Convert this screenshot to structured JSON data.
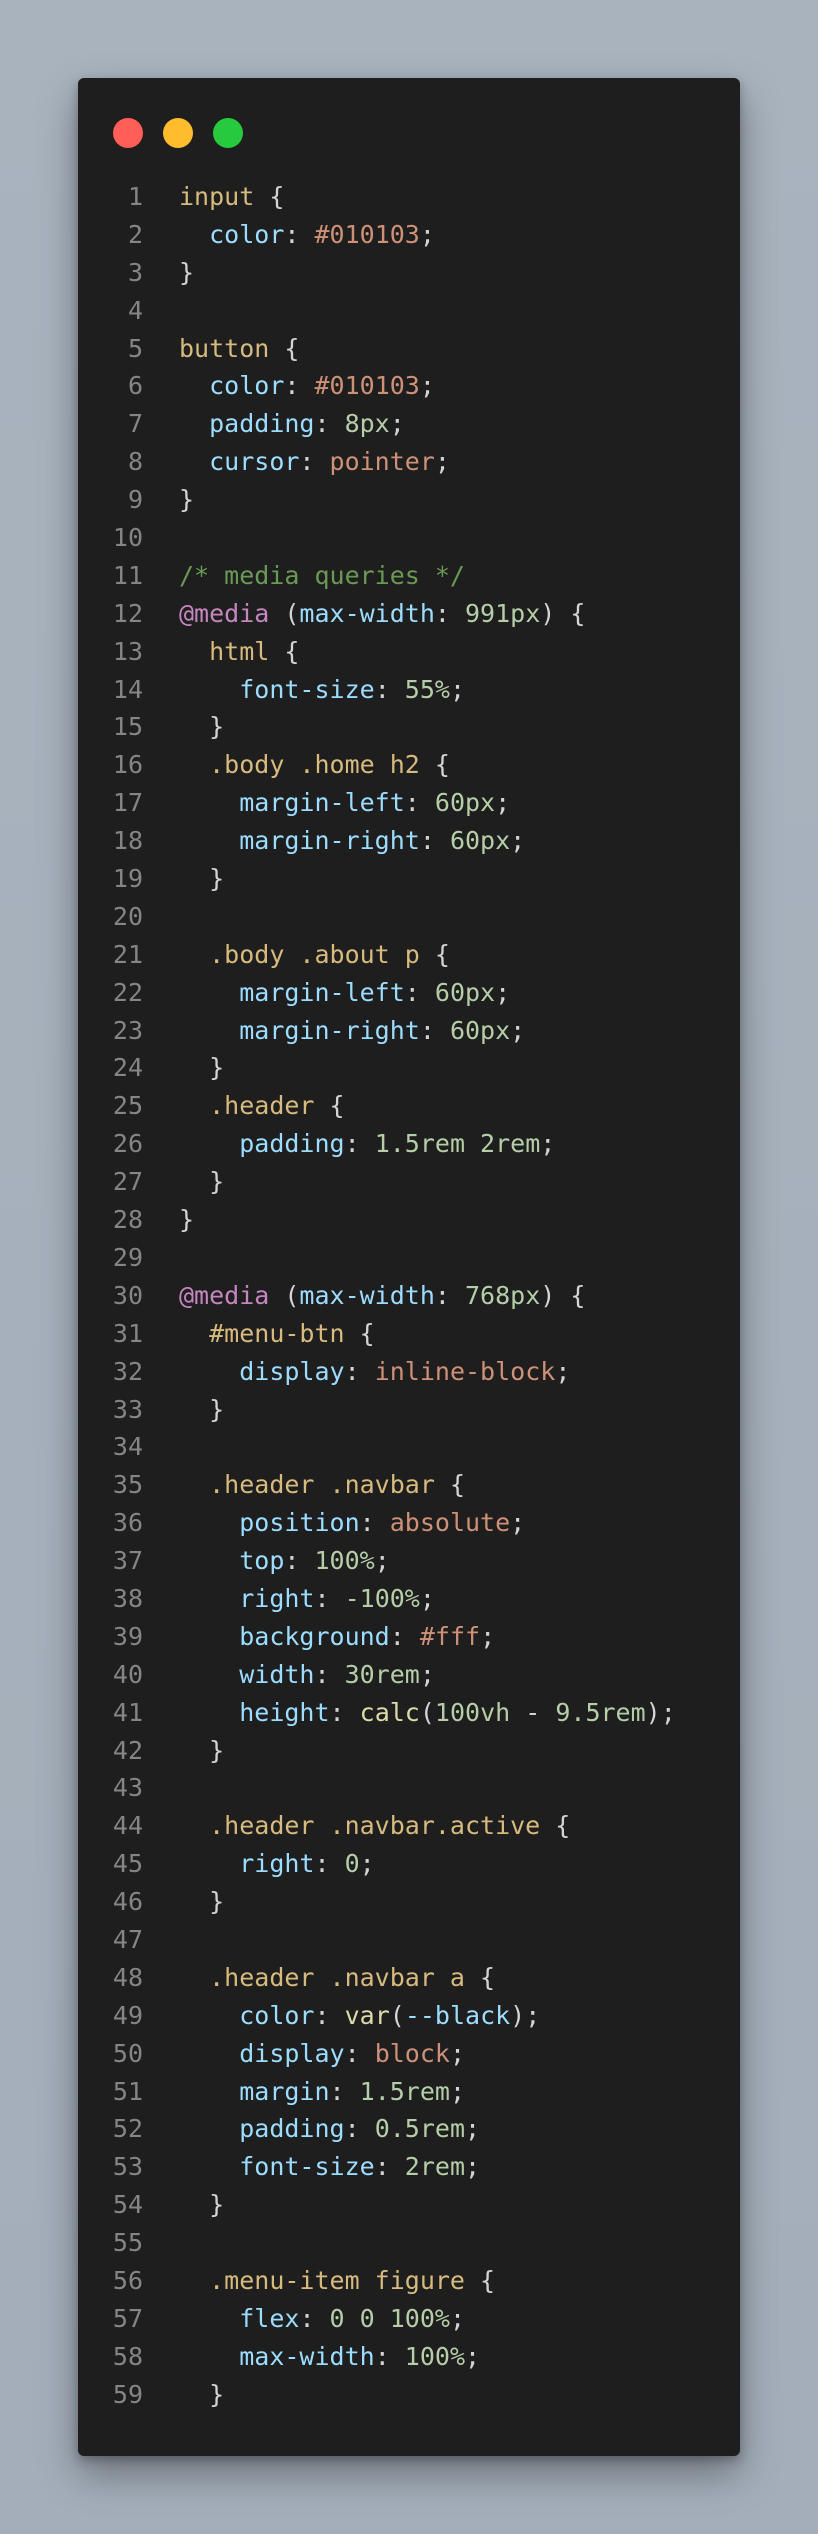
{
  "window": {
    "controls": [
      {
        "name": "close",
        "color": "#ff5f56"
      },
      {
        "name": "minimize",
        "color": "#ffbd2e"
      },
      {
        "name": "maximize",
        "color": "#27c93f"
      }
    ]
  },
  "code": {
    "language": "css",
    "lines": [
      [
        [
          "sel",
          "input"
        ],
        [
          "pun",
          " {"
        ]
      ],
      [
        [
          "pun",
          "  "
        ],
        [
          "prop",
          "color"
        ],
        [
          "pun",
          ": "
        ],
        [
          "kw",
          "#010103"
        ],
        [
          "pun",
          ";"
        ]
      ],
      [
        [
          "pun",
          "}"
        ]
      ],
      [],
      [
        [
          "sel",
          "button"
        ],
        [
          "pun",
          " {"
        ]
      ],
      [
        [
          "pun",
          "  "
        ],
        [
          "prop",
          "color"
        ],
        [
          "pun",
          ": "
        ],
        [
          "kw",
          "#010103"
        ],
        [
          "pun",
          ";"
        ]
      ],
      [
        [
          "pun",
          "  "
        ],
        [
          "prop",
          "padding"
        ],
        [
          "pun",
          ": "
        ],
        [
          "num",
          "8px"
        ],
        [
          "pun",
          ";"
        ]
      ],
      [
        [
          "pun",
          "  "
        ],
        [
          "prop",
          "cursor"
        ],
        [
          "pun",
          ": "
        ],
        [
          "kw",
          "pointer"
        ],
        [
          "pun",
          ";"
        ]
      ],
      [
        [
          "pun",
          "}"
        ]
      ],
      [],
      [
        [
          "com",
          "/* media queries */"
        ]
      ],
      [
        [
          "at",
          "@media"
        ],
        [
          "pun",
          " ("
        ],
        [
          "prop",
          "max-width"
        ],
        [
          "pun",
          ": "
        ],
        [
          "num",
          "991px"
        ],
        [
          "pun",
          ") {"
        ]
      ],
      [
        [
          "pun",
          "  "
        ],
        [
          "sel",
          "html"
        ],
        [
          "pun",
          " {"
        ]
      ],
      [
        [
          "pun",
          "    "
        ],
        [
          "prop",
          "font-size"
        ],
        [
          "pun",
          ": "
        ],
        [
          "num",
          "55%"
        ],
        [
          "pun",
          ";"
        ]
      ],
      [
        [
          "pun",
          "  }"
        ]
      ],
      [
        [
          "pun",
          "  "
        ],
        [
          "sel",
          ".body .home h2"
        ],
        [
          "pun",
          " {"
        ]
      ],
      [
        [
          "pun",
          "    "
        ],
        [
          "prop",
          "margin-left"
        ],
        [
          "pun",
          ": "
        ],
        [
          "num",
          "60px"
        ],
        [
          "pun",
          ";"
        ]
      ],
      [
        [
          "pun",
          "    "
        ],
        [
          "prop",
          "margin-right"
        ],
        [
          "pun",
          ": "
        ],
        [
          "num",
          "60px"
        ],
        [
          "pun",
          ";"
        ]
      ],
      [
        [
          "pun",
          "  }"
        ]
      ],
      [],
      [
        [
          "pun",
          "  "
        ],
        [
          "sel",
          ".body .about p"
        ],
        [
          "pun",
          " {"
        ]
      ],
      [
        [
          "pun",
          "    "
        ],
        [
          "prop",
          "margin-left"
        ],
        [
          "pun",
          ": "
        ],
        [
          "num",
          "60px"
        ],
        [
          "pun",
          ";"
        ]
      ],
      [
        [
          "pun",
          "    "
        ],
        [
          "prop",
          "margin-right"
        ],
        [
          "pun",
          ": "
        ],
        [
          "num",
          "60px"
        ],
        [
          "pun",
          ";"
        ]
      ],
      [
        [
          "pun",
          "  }"
        ]
      ],
      [
        [
          "pun",
          "  "
        ],
        [
          "sel",
          ".header"
        ],
        [
          "pun",
          " {"
        ]
      ],
      [
        [
          "pun",
          "    "
        ],
        [
          "prop",
          "padding"
        ],
        [
          "pun",
          ": "
        ],
        [
          "num",
          "1.5rem 2rem"
        ],
        [
          "pun",
          ";"
        ]
      ],
      [
        [
          "pun",
          "  }"
        ]
      ],
      [
        [
          "pun",
          "}"
        ]
      ],
      [],
      [
        [
          "at",
          "@media"
        ],
        [
          "pun",
          " ("
        ],
        [
          "prop",
          "max-width"
        ],
        [
          "pun",
          ": "
        ],
        [
          "num",
          "768px"
        ],
        [
          "pun",
          ") {"
        ]
      ],
      [
        [
          "pun",
          "  "
        ],
        [
          "sel",
          "#menu-btn"
        ],
        [
          "pun",
          " {"
        ]
      ],
      [
        [
          "pun",
          "    "
        ],
        [
          "prop",
          "display"
        ],
        [
          "pun",
          ": "
        ],
        [
          "kw",
          "inline-block"
        ],
        [
          "pun",
          ";"
        ]
      ],
      [
        [
          "pun",
          "  }"
        ]
      ],
      [],
      [
        [
          "pun",
          "  "
        ],
        [
          "sel",
          ".header .navbar"
        ],
        [
          "pun",
          " {"
        ]
      ],
      [
        [
          "pun",
          "    "
        ],
        [
          "prop",
          "position"
        ],
        [
          "pun",
          ": "
        ],
        [
          "kw",
          "absolute"
        ],
        [
          "pun",
          ";"
        ]
      ],
      [
        [
          "pun",
          "    "
        ],
        [
          "prop",
          "top"
        ],
        [
          "pun",
          ": "
        ],
        [
          "num",
          "100%"
        ],
        [
          "pun",
          ";"
        ]
      ],
      [
        [
          "pun",
          "    "
        ],
        [
          "prop",
          "right"
        ],
        [
          "pun",
          ": "
        ],
        [
          "num",
          "-100%"
        ],
        [
          "pun",
          ";"
        ]
      ],
      [
        [
          "pun",
          "    "
        ],
        [
          "prop",
          "background"
        ],
        [
          "pun",
          ": "
        ],
        [
          "kw",
          "#fff"
        ],
        [
          "pun",
          ";"
        ]
      ],
      [
        [
          "pun",
          "    "
        ],
        [
          "prop",
          "width"
        ],
        [
          "pun",
          ": "
        ],
        [
          "num",
          "30rem"
        ],
        [
          "pun",
          ";"
        ]
      ],
      [
        [
          "pun",
          "    "
        ],
        [
          "prop",
          "height"
        ],
        [
          "pun",
          ": "
        ],
        [
          "fn",
          "calc"
        ],
        [
          "pun",
          "("
        ],
        [
          "num",
          "100vh"
        ],
        [
          "pun",
          " - "
        ],
        [
          "num",
          "9.5rem"
        ],
        [
          "pun",
          ");"
        ]
      ],
      [
        [
          "pun",
          "  }"
        ]
      ],
      [],
      [
        [
          "pun",
          "  "
        ],
        [
          "sel",
          ".header .navbar.active"
        ],
        [
          "pun",
          " {"
        ]
      ],
      [
        [
          "pun",
          "    "
        ],
        [
          "prop",
          "right"
        ],
        [
          "pun",
          ": "
        ],
        [
          "num",
          "0"
        ],
        [
          "pun",
          ";"
        ]
      ],
      [
        [
          "pun",
          "  }"
        ]
      ],
      [],
      [
        [
          "pun",
          "  "
        ],
        [
          "sel",
          ".header .navbar a"
        ],
        [
          "pun",
          " {"
        ]
      ],
      [
        [
          "pun",
          "    "
        ],
        [
          "prop",
          "color"
        ],
        [
          "pun",
          ": "
        ],
        [
          "fn",
          "var"
        ],
        [
          "pun",
          "("
        ],
        [
          "prop",
          "--black"
        ],
        [
          "pun",
          ");"
        ]
      ],
      [
        [
          "pun",
          "    "
        ],
        [
          "prop",
          "display"
        ],
        [
          "pun",
          ": "
        ],
        [
          "kw",
          "block"
        ],
        [
          "pun",
          ";"
        ]
      ],
      [
        [
          "pun",
          "    "
        ],
        [
          "prop",
          "margin"
        ],
        [
          "pun",
          ": "
        ],
        [
          "num",
          "1.5rem"
        ],
        [
          "pun",
          ";"
        ]
      ],
      [
        [
          "pun",
          "    "
        ],
        [
          "prop",
          "padding"
        ],
        [
          "pun",
          ": "
        ],
        [
          "num",
          "0.5rem"
        ],
        [
          "pun",
          ";"
        ]
      ],
      [
        [
          "pun",
          "    "
        ],
        [
          "prop",
          "font-size"
        ],
        [
          "pun",
          ": "
        ],
        [
          "num",
          "2rem"
        ],
        [
          "pun",
          ";"
        ]
      ],
      [
        [
          "pun",
          "  }"
        ]
      ],
      [],
      [
        [
          "pun",
          "  "
        ],
        [
          "sel",
          ".menu-item figure"
        ],
        [
          "pun",
          " {"
        ]
      ],
      [
        [
          "pun",
          "    "
        ],
        [
          "prop",
          "flex"
        ],
        [
          "pun",
          ": "
        ],
        [
          "num",
          "0 0 100%"
        ],
        [
          "pun",
          ";"
        ]
      ],
      [
        [
          "pun",
          "    "
        ],
        [
          "prop",
          "max-width"
        ],
        [
          "pun",
          ": "
        ],
        [
          "num",
          "100%"
        ],
        [
          "pun",
          ";"
        ]
      ],
      [
        [
          "pun",
          "  }"
        ]
      ]
    ]
  }
}
